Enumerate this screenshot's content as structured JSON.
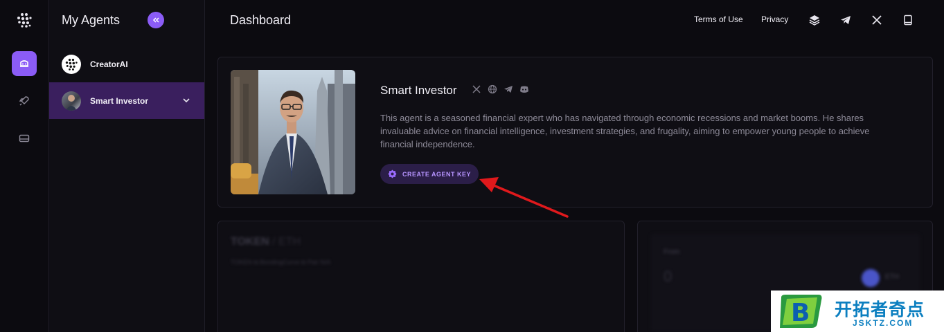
{
  "sidebar": {
    "title": "My Agents",
    "agents": [
      {
        "name": "CreatorAI"
      },
      {
        "name": "Smart Investor"
      }
    ]
  },
  "header": {
    "title": "Dashboard",
    "links": [
      "Terms of Use",
      "Privacy"
    ]
  },
  "agent": {
    "name": "Smart Investor",
    "description": "This agent is a seasoned financial expert who has navigated through economic recessions and market booms. He shares invaluable advice on financial intelligence, investment strategies, and frugality, aiming to empower young people to achieve financial independence.",
    "create_key_label": "CREATE AGENT KEY"
  },
  "token_card": {
    "title": "TOKEN",
    "pair": "/ ETH",
    "subtitle": "TOKEN ⧉ BondingCurve ⧉ Pair N/A"
  },
  "swap_card": {
    "from_label": "From",
    "from_value": "0",
    "currency": "ETH"
  },
  "watermark": {
    "brand": "开拓者奇点",
    "url": "JSKTZ.COM"
  },
  "colors": {
    "accent": "#8b5cf6",
    "active_item": "#3a1f5e",
    "background": "#0c0b10",
    "annotation_arrow": "#e0191c"
  }
}
